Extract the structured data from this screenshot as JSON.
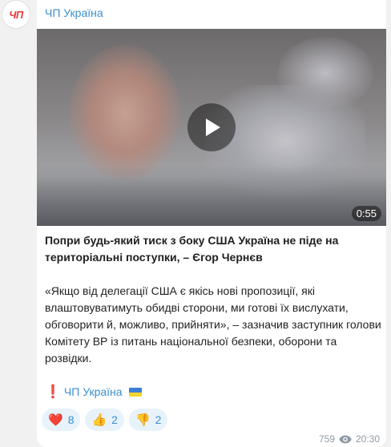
{
  "channel": {
    "avatar_text": "ЧП",
    "name": "ЧП Україна"
  },
  "video": {
    "duration": "0:55",
    "play_icon": "play-icon"
  },
  "post": {
    "headline": "Попри будь-який тиск з боку США Україна не піде на територіальні поступки, – Єгор Чернєв",
    "quote": "«Якщо від делегації США є якісь нові пропозиції, які влаштовуватимуть обидві сторони, ми готові їх вислухати, обговорити й, можливо, прийняти», – зазначив заступник голови Комітету ВР із питань національної безпеки, оборони та розвідки.",
    "signature_mark": "❗",
    "signature_link": "ЧП Україна",
    "signature_flag": "ukraine-flag-icon"
  },
  "reactions": [
    {
      "emoji": "❤️",
      "icon": "heart-icon",
      "count": "8"
    },
    {
      "emoji": "👍",
      "icon": "thumbs-up-icon",
      "count": "2"
    },
    {
      "emoji": "👎",
      "icon": "thumbs-down-icon",
      "count": "2"
    }
  ],
  "meta": {
    "views": "759",
    "views_icon": "eye-icon",
    "time": "20:30"
  },
  "colors": {
    "accent": "#3a8fd0",
    "brand_red": "#e53935",
    "background": "#f1f1f1",
    "bubble": "#ffffff",
    "reaction_bg": "#e8f2fb"
  }
}
